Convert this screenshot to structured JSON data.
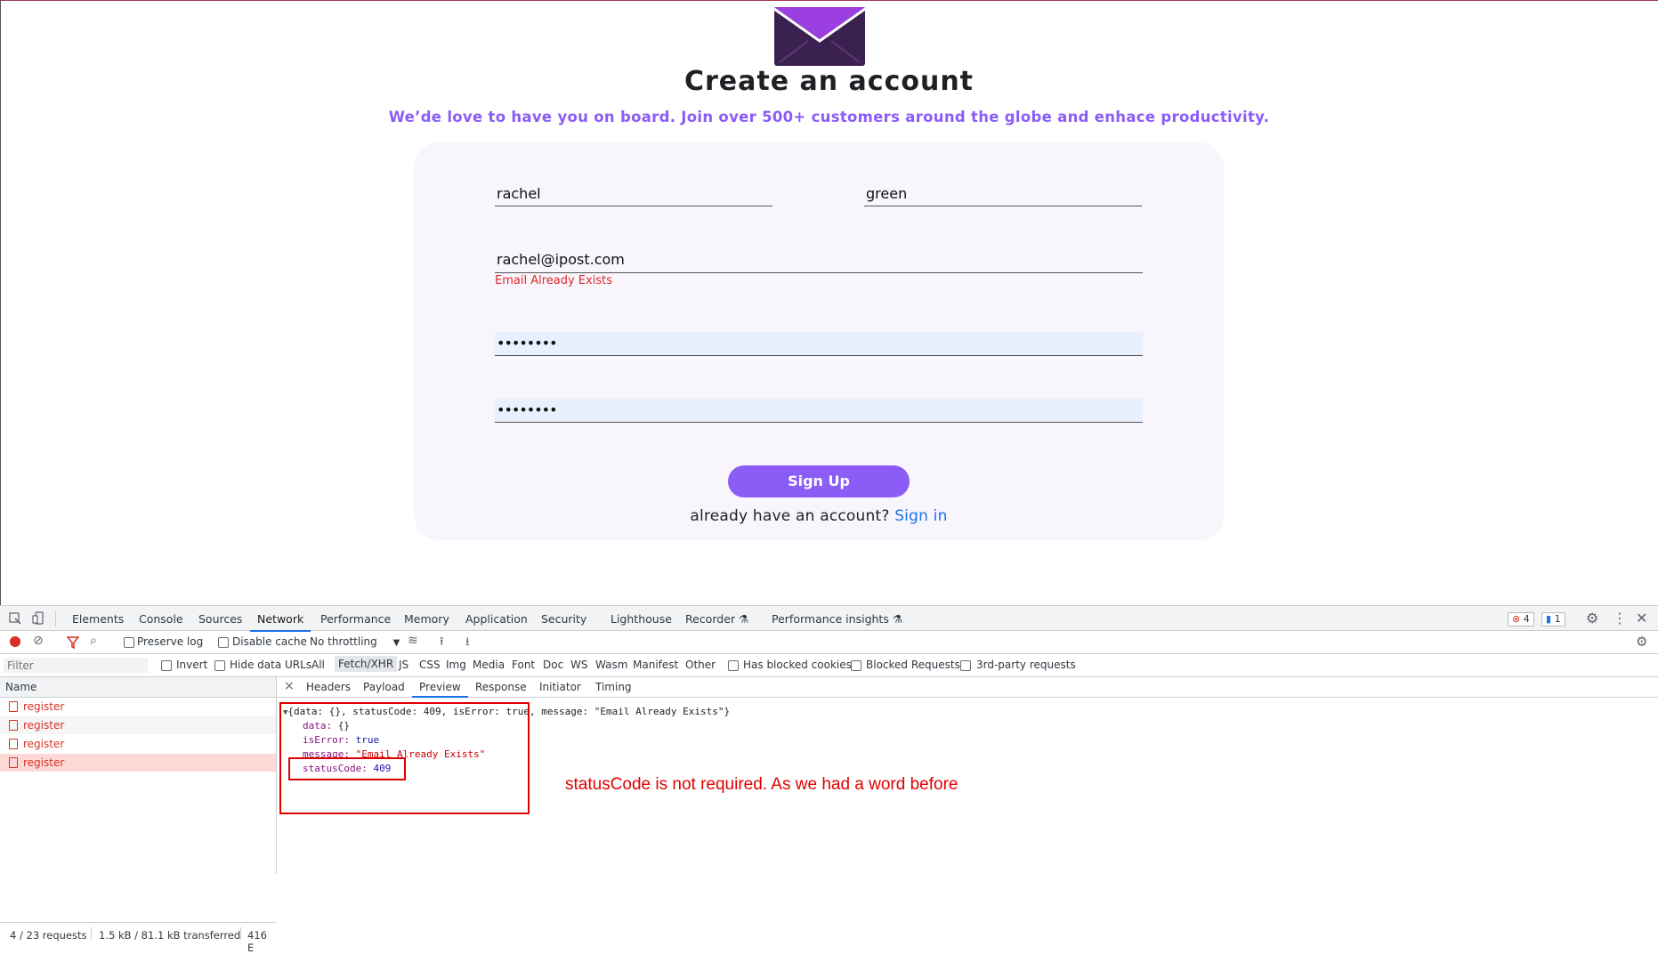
{
  "app": {
    "title": "Create an account",
    "subtitle": "We’de love to have you on board. Join over 500+ customers around the globe and enhace productivity.",
    "form": {
      "first_name": "rachel",
      "last_name": "green",
      "email": "rachel@ipost.com",
      "email_error": "Email Already Exists",
      "password_mask": "••••••••",
      "confirm_password_mask": "••••••••",
      "signup_label": "Sign Up",
      "have_account_text": "already have an account?",
      "signin_label": "Sign in"
    },
    "colors": {
      "accent": "#8b5cf6",
      "error": "#e0292a",
      "card_bg": "#f8f5fd",
      "logo_dark": "#3a2150",
      "logo_purple": "#9b3fe0"
    }
  },
  "devtools": {
    "tabs": [
      "Elements",
      "Console",
      "Sources",
      "Network",
      "Performance",
      "Memory",
      "Application",
      "Security",
      "Lighthouse",
      "Recorder",
      "Performance insights"
    ],
    "active_tab": "Network",
    "error_count": "4",
    "message_count": "1",
    "toolbar": {
      "preserve_log": "Preserve log",
      "disable_cache": "Disable cache",
      "throttling": "No throttling"
    },
    "filter": {
      "placeholder": "Filter",
      "invert": "Invert",
      "hide_data_urls": "Hide data URLs",
      "types": [
        "All",
        "Fetch/XHR",
        "JS",
        "CSS",
        "Img",
        "Media",
        "Font",
        "Doc",
        "WS",
        "Wasm",
        "Manifest",
        "Other"
      ],
      "active_type": "Fetch/XHR",
      "has_blocked_cookies": "Has blocked cookies",
      "blocked_requests": "Blocked Requests",
      "third_party": "3rd-party requests"
    },
    "list": {
      "header": "Name",
      "requests": [
        "register",
        "register",
        "register",
        "register"
      ]
    },
    "status": {
      "requests": "4 / 23 requests",
      "transferred": "1.5 kB / 81.1 kB transferred",
      "resources": "416 E"
    },
    "preview_tabs": [
      "Headers",
      "Payload",
      "Preview",
      "Response",
      "Initiator",
      "Timing"
    ],
    "active_preview_tab": "Preview",
    "close_glyph": "×",
    "preview": {
      "summary": "{data: {}, statusCode: 409, isError: true, message: \"Email Already Exists\"}",
      "data_key": "data:",
      "data_val": "{}",
      "isError_key": "isError:",
      "isError_val": "true",
      "message_key": "message:",
      "message_val": "\"Email Already Exists\"",
      "statusCode_key": "statusCode:",
      "statusCode_val": "409"
    }
  },
  "annotation": {
    "note": "statusCode is not required. As we had a word before"
  }
}
